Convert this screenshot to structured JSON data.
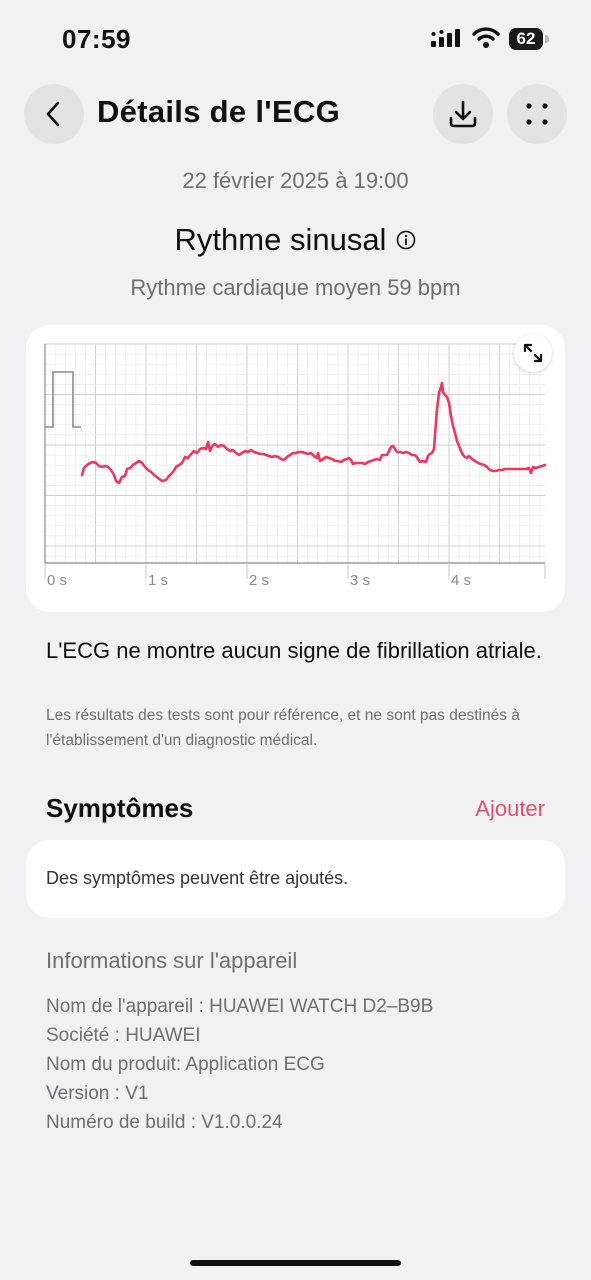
{
  "status_bar": {
    "time": "07:59",
    "battery": "62"
  },
  "header": {
    "title": "Détails de l'ECG"
  },
  "summary": {
    "date": "22 février 2025 à 19:00",
    "rhythm": "Rythme sinusal",
    "average": "Rythme cardiaque moyen 59 bpm"
  },
  "ecg": {
    "x_labels": [
      "0 s",
      "1 s",
      "2 s",
      "3 s",
      "4 s"
    ],
    "line_color": "#f0365f"
  },
  "result": {
    "main": "L'ECG ne montre aucun signe de fibrillation atriale.",
    "disclaimer": "Les résultats des tests sont pour référence, et ne sont pas destinés à l'établissement d'un diagnostic médical."
  },
  "symptoms": {
    "title": "Symptômes",
    "add_label": "Ajouter",
    "placeholder": "Des symptômes peuvent être ajoutés."
  },
  "device": {
    "title": "Informations sur l'appareil",
    "lines": [
      "Nom de l'appareil : HUAWEI WATCH D2–B9B",
      "Société : HUAWEI",
      "Nom du produit: Application ECG",
      "Version : V1",
      "Numéro de build : V1.0.0.24"
    ]
  },
  "colors": {
    "accent": "#e0506b",
    "background": "#f1f1f3"
  }
}
